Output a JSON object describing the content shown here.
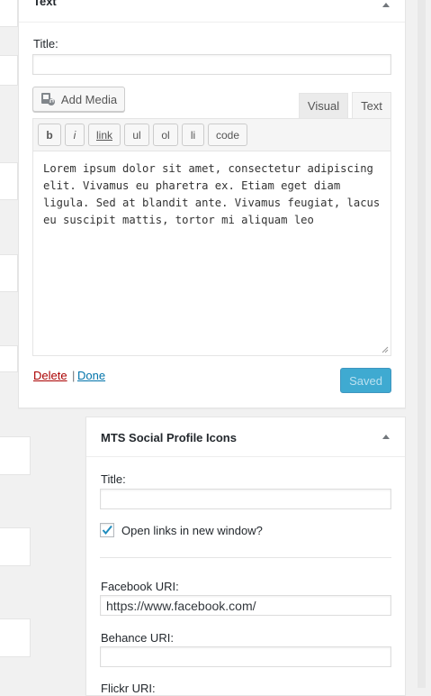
{
  "text_widget": {
    "title": "Text",
    "title_label": "Title:",
    "title_value": "",
    "add_media_label": "Add Media",
    "tab_visual": "Visual",
    "tab_text": "Text",
    "quicktags": [
      "b",
      "i",
      "link",
      "ul",
      "ol",
      "li",
      "code"
    ],
    "content": "Lorem ipsum dolor sit amet, consectetur adipiscing elit. Vivamus eu pharetra ex. Etiam eget diam ligula. Sed at blandit ante. Vivamus feugiat, lacus eu suscipit mattis, tortor mi aliquam leo",
    "delete_label": "Delete",
    "separator": "|",
    "done_label": "Done",
    "saved_label": "Saved"
  },
  "social_widget": {
    "title": "MTS Social Profile Icons",
    "title_label": "Title:",
    "title_value": "",
    "checkbox_label": "Open links in new window?",
    "checkbox_checked": true,
    "facebook_label": "Facebook URI:",
    "facebook_value": "https://www.facebook.com/",
    "behance_label": "Behance URI:",
    "behance_value": "",
    "flickr_label": "Flickr URI:"
  },
  "colors": {
    "accent": "#0073aa",
    "delete": "#a00",
    "primary_button": "#008ec2"
  }
}
